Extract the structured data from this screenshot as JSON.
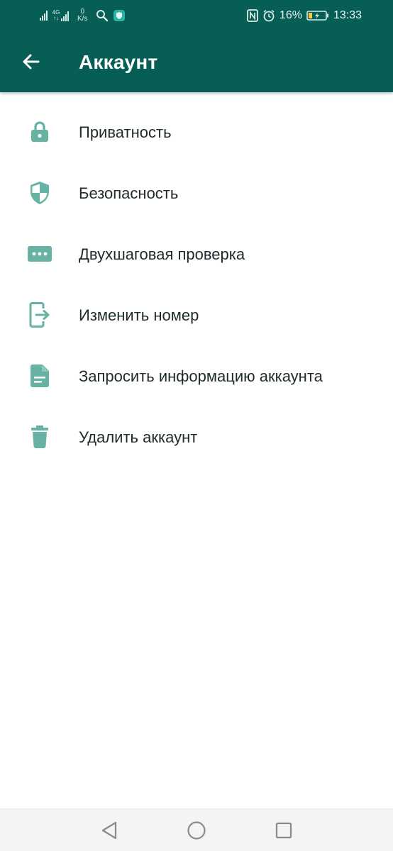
{
  "status_bar": {
    "network_top": "4G",
    "speed_value": "0",
    "speed_unit": "K/s",
    "battery": "16%",
    "time": "13:33"
  },
  "header": {
    "title": "Аккаунт"
  },
  "menu": {
    "items": [
      {
        "label": "Приватность",
        "icon": "lock-icon"
      },
      {
        "label": "Безопасность",
        "icon": "shield-icon"
      },
      {
        "label": "Двухшаговая проверка",
        "icon": "dots-icon"
      },
      {
        "label": "Изменить номер",
        "icon": "change-number-icon"
      },
      {
        "label": "Запросить информацию аккаунта",
        "icon": "document-icon"
      },
      {
        "label": "Удалить аккаунт",
        "icon": "trash-icon"
      }
    ]
  },
  "colors": {
    "primary_dark": "#075e54",
    "icon_teal": "#66b2a4",
    "text": "#1f2a2c"
  }
}
